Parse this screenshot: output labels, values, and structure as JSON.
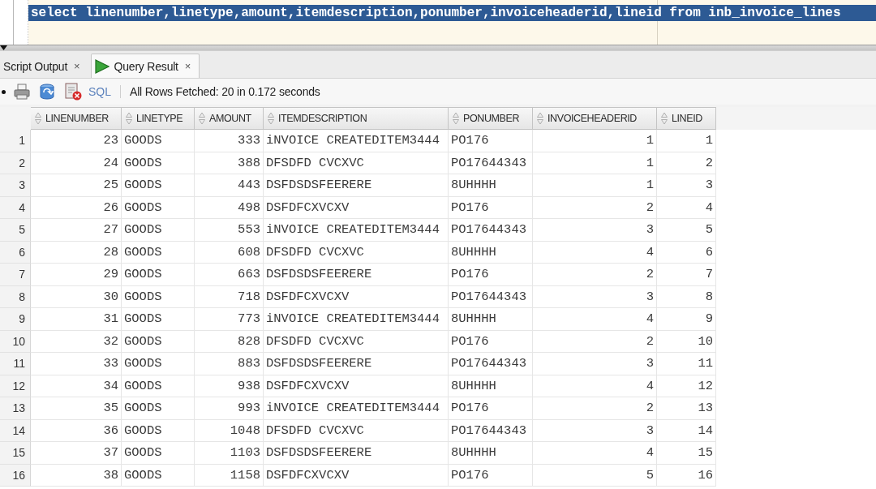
{
  "editor": {
    "lines": [
      {
        "text": "select linenumber,linetype,amount,itemdescription,ponumber,invoiceheaderid,lineid from inb_invoice_lines",
        "selected": true
      }
    ]
  },
  "result_tabs": [
    {
      "label": "Script Output",
      "close": "×",
      "kind": "output",
      "selected": false
    },
    {
      "label": "Query Result",
      "close": "×",
      "kind": "result",
      "selected": true
    }
  ],
  "toolbar": {
    "sql_link": "SQL",
    "status": "All Rows Fetched: 20 in 0.172 seconds"
  },
  "table": {
    "columns": [
      {
        "label": "LINENUMBER",
        "kind": "number"
      },
      {
        "label": "LINETYPE",
        "kind": "text"
      },
      {
        "label": "AMOUNT",
        "kind": "number"
      },
      {
        "label": "ITEMDESCRIPTION",
        "kind": "text"
      },
      {
        "label": "PONUMBER",
        "kind": "text"
      },
      {
        "label": "INVOICEHEADERID",
        "kind": "number"
      },
      {
        "label": "LINEID",
        "kind": "number"
      }
    ],
    "rows": [
      {
        "number": "1",
        "cells": [
          "23",
          "GOODS",
          "333",
          "iNVOICE CREATEDITEM3444",
          "PO176",
          "1",
          "1"
        ]
      },
      {
        "number": "2",
        "cells": [
          "24",
          "GOODS",
          "388",
          "DFSDFD CVCXVC",
          "PO17644343",
          "1",
          "2"
        ]
      },
      {
        "number": "3",
        "cells": [
          "25",
          "GOODS",
          "443",
          "DSFDSDSFEERERE",
          "8UHHHH",
          "1",
          "3"
        ]
      },
      {
        "number": "4",
        "cells": [
          "26",
          "GOODS",
          "498",
          "DSFDFCXVCXV",
          "PO176",
          "2",
          "4"
        ]
      },
      {
        "number": "5",
        "cells": [
          "27",
          "GOODS",
          "553",
          "iNVOICE CREATEDITEM3444",
          "PO17644343",
          "3",
          "5"
        ]
      },
      {
        "number": "6",
        "cells": [
          "28",
          "GOODS",
          "608",
          "DFSDFD CVCXVC",
          "8UHHHH",
          "4",
          "6"
        ]
      },
      {
        "number": "7",
        "cells": [
          "29",
          "GOODS",
          "663",
          "DSFDSDSFEERERE",
          "PO176",
          "2",
          "7"
        ]
      },
      {
        "number": "8",
        "cells": [
          "30",
          "GOODS",
          "718",
          "DSFDFCXVCXV",
          "PO17644343",
          "3",
          "8"
        ]
      },
      {
        "number": "9",
        "cells": [
          "31",
          "GOODS",
          "773",
          "iNVOICE CREATEDITEM3444",
          "8UHHHH",
          "4",
          "9"
        ]
      },
      {
        "number": "10",
        "cells": [
          "32",
          "GOODS",
          "828",
          "DFSDFD CVCXVC",
          "PO176",
          "2",
          "10"
        ]
      },
      {
        "number": "11",
        "cells": [
          "33",
          "GOODS",
          "883",
          "DSFDSDSFEERERE",
          "PO17644343",
          "3",
          "11"
        ]
      },
      {
        "number": "12",
        "cells": [
          "34",
          "GOODS",
          "938",
          "DSFDFCXVCXV",
          "8UHHHH",
          "4",
          "12"
        ]
      },
      {
        "number": "13",
        "cells": [
          "35",
          "GOODS",
          "993",
          "iNVOICE CREATEDITEM3444",
          "PO176",
          "2",
          "13"
        ]
      },
      {
        "number": "14",
        "cells": [
          "36",
          "GOODS",
          "1048",
          "DFSDFD CVCXVC",
          "PO17644343",
          "3",
          "14"
        ]
      },
      {
        "number": "15",
        "cells": [
          "37",
          "GOODS",
          "1103",
          "DSFDSDSFEERERE",
          "8UHHHH",
          "4",
          "15"
        ]
      },
      {
        "number": "16",
        "cells": [
          "38",
          "GOODS",
          "1158",
          "DSFDFCXVCXV",
          "PO176",
          "5",
          "16"
        ]
      }
    ]
  }
}
